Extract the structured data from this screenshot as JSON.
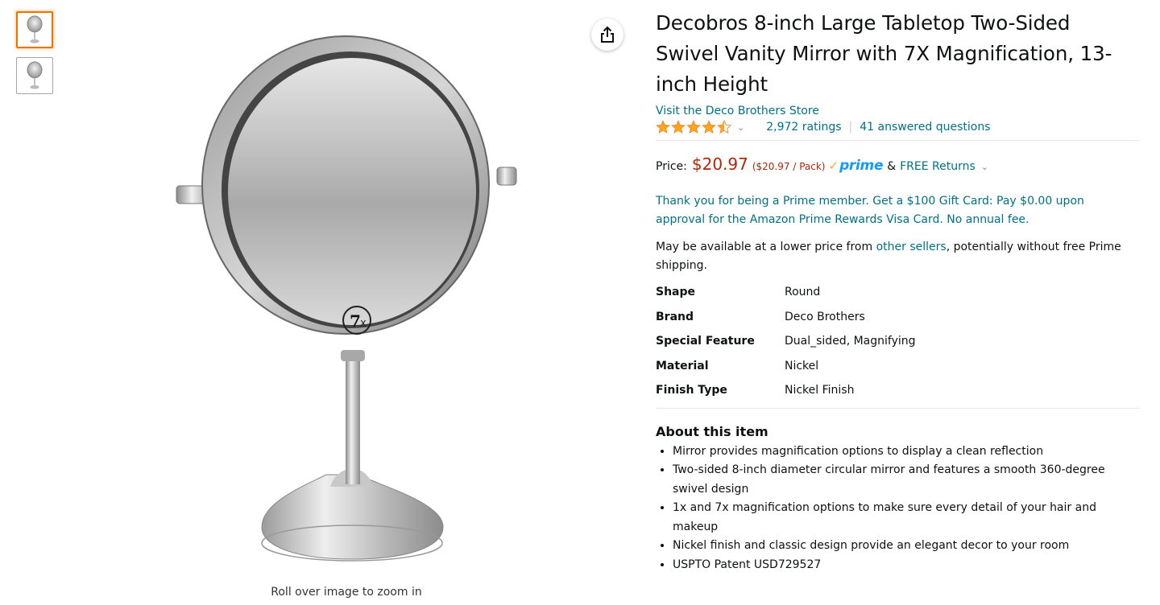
{
  "gallery": {
    "thumbnails": [
      {
        "icon": "mirror-front-thumbnail",
        "selected": true
      },
      {
        "icon": "mirror-angle-thumbnail",
        "selected": false
      }
    ],
    "main_image": {
      "icon": "mirror-product-image",
      "badge": "7X"
    },
    "zoom_hint": "Roll over image to zoom in"
  },
  "share": {
    "icon": "share-icon"
  },
  "product": {
    "title": "Decobros 8-inch Large Tabletop Two-Sided Swivel Vanity Mirror with 7X Magnification, 13-inch Height",
    "store_link": "Visit the Deco Brothers Store",
    "rating": {
      "stars": 4.5,
      "ratings_text": "2,972 ratings",
      "separator": "|",
      "questions_text": "41 answered questions"
    },
    "price": {
      "label": "Price:",
      "value": "$20.97",
      "unit": "($20.97 / Pack)",
      "prime_check": "✓",
      "prime_label": "prime",
      "amp": "&",
      "returns": "FREE Returns"
    },
    "promo": "Thank you for being a Prime member. Get a $100 Gift Card: Pay $0.00 upon approval for the Amazon Prime Rewards Visa Card. No annual fee.",
    "seller_note": {
      "before": "May be available at a lower price from ",
      "link": "other sellers",
      "after": ", potentially without free Prime shipping."
    },
    "specs": [
      {
        "key": "Shape",
        "value": "Round"
      },
      {
        "key": "Brand",
        "value": "Deco Brothers"
      },
      {
        "key": "Special Feature",
        "value": "Dual_sided, Magnifying"
      },
      {
        "key": "Material",
        "value": "Nickel"
      },
      {
        "key": "Finish Type",
        "value": "Nickel Finish"
      }
    ],
    "about": {
      "title": "About this item",
      "bullets": [
        "Mirror provides magnification options to display a clean reflection",
        "Two-sided 8-inch diameter circular mirror and features a smooth 360-degree swivel design",
        "1x and 7x magnification options to make sure every detail of your hair and makeup",
        "Nickel finish and classic design provide an elegant decor to your room",
        "USPTO Patent USD729527"
      ]
    }
  },
  "colors": {
    "star": "#ffa41c",
    "link": "#007185",
    "price": "#b12704",
    "prime": "#1399ff",
    "selected_border": "#e77600"
  }
}
